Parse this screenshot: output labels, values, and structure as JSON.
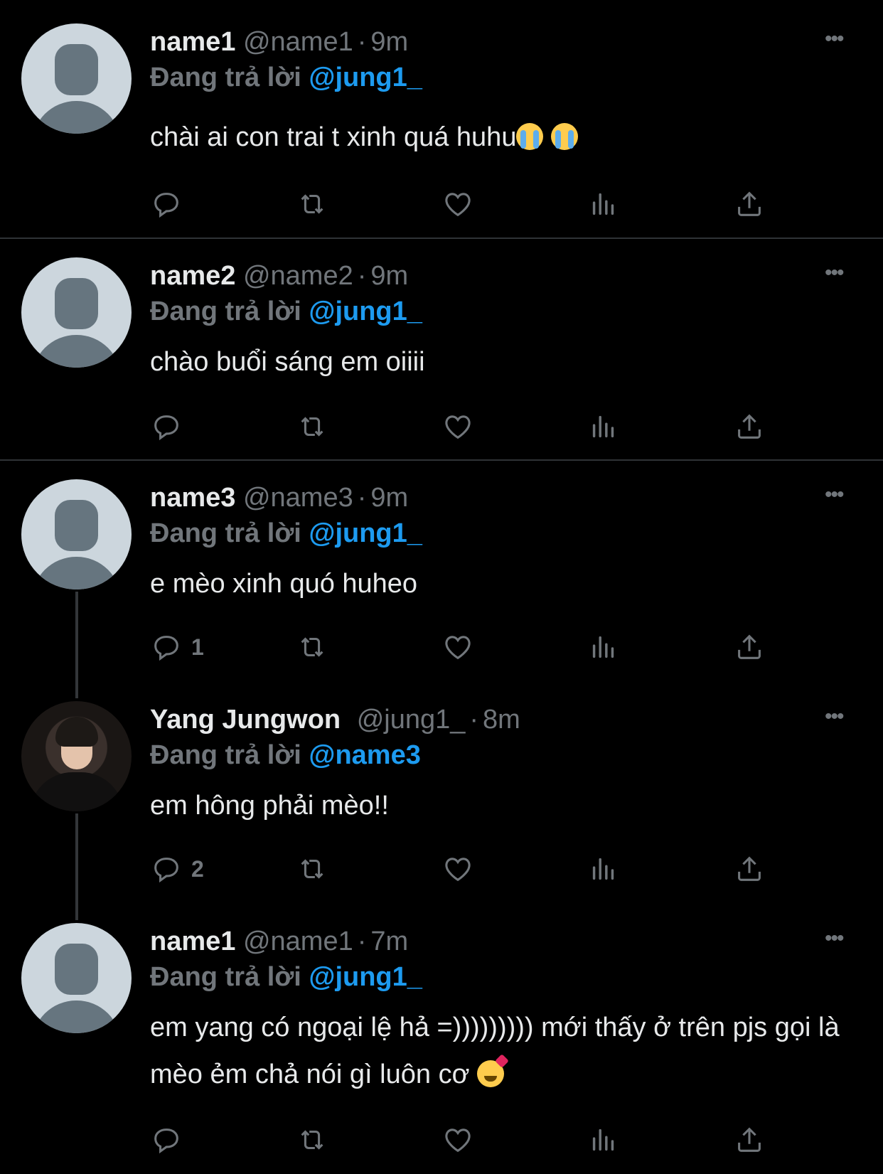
{
  "tweets": [
    {
      "name": "name1",
      "handle": "@name1",
      "time": "9m",
      "replying_prefix": "Đang trả lời",
      "replying_to": "@jung1_",
      "text": "chài ai con trai t xinh quá huhu",
      "emojis": [
        "loudly-crying-face",
        "loudly-crying-face"
      ],
      "reply_count": "",
      "avatar": "default"
    },
    {
      "name": "name2",
      "handle": "@name2",
      "time": "9m",
      "replying_prefix": "Đang trả lời",
      "replying_to": "@jung1_",
      "text": "chào buổi sáng em oiiii",
      "reply_count": "",
      "avatar": "default"
    },
    {
      "name": "name3",
      "handle": "@name3",
      "time": "9m",
      "replying_prefix": "Đang trả lời",
      "replying_to": "@jung1_",
      "text": "e mèo xinh quó huheo",
      "reply_count": "1",
      "avatar": "default"
    },
    {
      "name": "Yang Jungwon",
      "handle": "@jung1_",
      "time": "8m",
      "replying_prefix": "Đang trả lời",
      "replying_to": "@name3",
      "text": "em hông phải mèo!!",
      "reply_count": "2",
      "avatar": "photo"
    },
    {
      "name": "name1",
      "handle": "@name1",
      "time": "7m",
      "replying_prefix": "Đang trả lời",
      "replying_to": "@jung1_",
      "text": "em yang có ngoại lệ hả =))))))))) mới thấy ở trên pjs gọi là mèo ẻm chả nói gì luôn cơ",
      "emojis": [
        "smiling-face-with-hearts"
      ],
      "reply_count": "",
      "avatar": "default"
    }
  ],
  "separator": "·",
  "colors": {
    "background": "#000000",
    "text": "#e7e9ea",
    "muted": "#71767b",
    "accent": "#1d9bf0"
  },
  "icons": [
    "reply-icon",
    "retweet-icon",
    "like-icon",
    "analytics-icon",
    "share-icon",
    "more-icon"
  ]
}
